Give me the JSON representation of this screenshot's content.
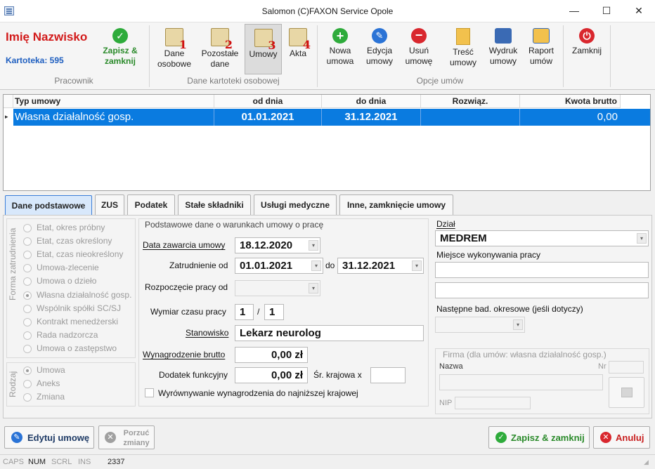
{
  "window": {
    "title": "Salomon (C)FAXON Service Opole",
    "minimize": "—",
    "maximize": "☐",
    "close": "✕"
  },
  "ribbon": {
    "employee_name": "Imię Nazwisko",
    "kartoteka": "Kartoteka: 595",
    "save_close": "Zapisz & zamknij",
    "group_pracownik": "Pracownik",
    "dane_osobowe": "Dane osobowe",
    "dane_osobowe_num": "1",
    "pozostale_dane": "Pozostałe dane",
    "pozostale_dane_num": "2",
    "umowy": "Umowy",
    "umowy_num": "3",
    "akta": "Akta",
    "akta_num": "4",
    "group_dane": "Dane kartoteki osobowej",
    "nowa_umowa": "Nowa umowa",
    "edycja_umowy": "Edycja umowy",
    "usun_umowe": "Usuń umowę",
    "tresc_umowy": "Treść umowy",
    "wydruk_umowy": "Wydruk umowy",
    "raport_umow": "Raport umów",
    "group_opcje": "Opcje umów",
    "zamknij": "Zamknij"
  },
  "grid": {
    "headers": [
      "Typ umowy",
      "od dnia",
      "do dnia",
      "Rozwiąz.",
      "Kwota brutto"
    ],
    "rows": [
      {
        "typ": "Własna działalność gosp.",
        "od": "01.01.2021",
        "do": "31.12.2021",
        "rozwiaz": "",
        "kwota": "0,00"
      }
    ]
  },
  "tabs": [
    "Dane podstawowe",
    "ZUS",
    "Podatek",
    "Stałe składniki",
    "Usługi medyczne",
    "Inne, zamknięcie umowy"
  ],
  "forma": {
    "label": "Forma zatrudnienia",
    "options": [
      "Etat, okres próbny",
      "Etat, czas określony",
      "Etat, czas nieokreślony",
      "Umowa-zlecenie",
      "Umowa o dzieło",
      "Własna działalność gosp.",
      "Wspólnik spółki SC/SJ",
      "Kontrakt menedżerski",
      "Rada nadzorcza",
      "Umowa o zastępstwo"
    ],
    "selected": 5
  },
  "rodzaj": {
    "label": "Rodzaj",
    "options": [
      "Umowa",
      "Aneks",
      "Zmiana"
    ],
    "selected": 0
  },
  "warunki": {
    "legend": "Podstawowe dane o warunkach umowy o pracę",
    "data_zawarcia_label": "Data zawarcia umowy",
    "data_zawarcia": "18.12.2020",
    "zatrudnienie_label": "Zatrudnienie od",
    "zatrudnienie_od": "01.01.2021",
    "do_label": "do",
    "zatrudnienie_do": "31.12.2021",
    "rozpoczecie_label": "Rozpoczęcie pracy od",
    "rozpoczecie": "",
    "wymiar_label": "Wymiar czasu pracy",
    "wymiar_a": "1",
    "wymiar_sep": "/",
    "wymiar_b": "1",
    "stanowisko_label": "Stanowisko",
    "stanowisko": "Lekarz neurolog",
    "wynagrodzenie_label": "Wynagrodzenie brutto",
    "wynagrodzenie": "0,00 zł",
    "dodatek_label": "Dodatek funkcyjny",
    "dodatek": "0,00 zł",
    "sr_krajowa_label": "Śr. krajowa x",
    "sr_krajowa": "",
    "wyrownywanie_label": "Wyrównywanie wynagrodzenia do najniższej krajowej"
  },
  "right": {
    "dzial_label": "Dział",
    "dzial": "MEDREM",
    "miejsce_label": "Miejsce wykonywania pracy",
    "miejsce_1": "",
    "miejsce_2": "",
    "badania_label": "Następne bad. okresowe (jeśli dotyczy)",
    "firma_legend": "Firma (dla umów: własna działalność gosp.)",
    "nazwa_label": "Nazwa",
    "nr_label": "Nr",
    "nip_label": "NIP"
  },
  "footer": {
    "edytuj": "Edytuj umowę",
    "porzuc": "Porzuć zmiany",
    "zapisz": "Zapisz & zamknij",
    "anuluj": "Anuluj"
  },
  "statusbar": {
    "caps": "CAPS",
    "num": "NUM",
    "scrl": "SCRL",
    "ins": "INS",
    "code": "2337"
  },
  "colors": {
    "accent": "#0a7be0",
    "name_red": "#d21a1a",
    "kartoteka_blue": "#1f5fc0",
    "green": "#2eab3b",
    "red": "#d9272e"
  }
}
